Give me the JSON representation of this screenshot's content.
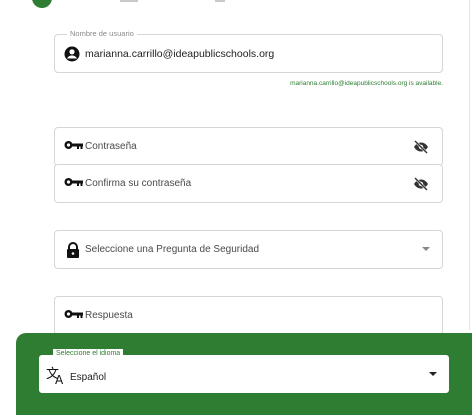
{
  "form": {
    "username": {
      "legend": "Nombre de usuario",
      "value": "marianna.carrillo@ideapublicschools.org",
      "helper": "marianna.carrillo@ideapublicschools.org is available."
    },
    "password": {
      "placeholder": "Contraseña"
    },
    "confirm_password": {
      "placeholder": "Confirma su contraseña"
    },
    "security_question": {
      "placeholder": "Seleccione una Pregunta de Seguridad"
    },
    "answer": {
      "placeholder": "Respuesta"
    }
  },
  "language": {
    "legend": "Seleccione el idioma",
    "value": "Español"
  },
  "colors": {
    "accent_green": "#2e7d32",
    "border": "#d6d6d6"
  },
  "icons": [
    "account-circle-icon",
    "key-icon",
    "visibility-off-icon",
    "lock-icon",
    "dropdown-arrow-icon",
    "translate-icon"
  ]
}
